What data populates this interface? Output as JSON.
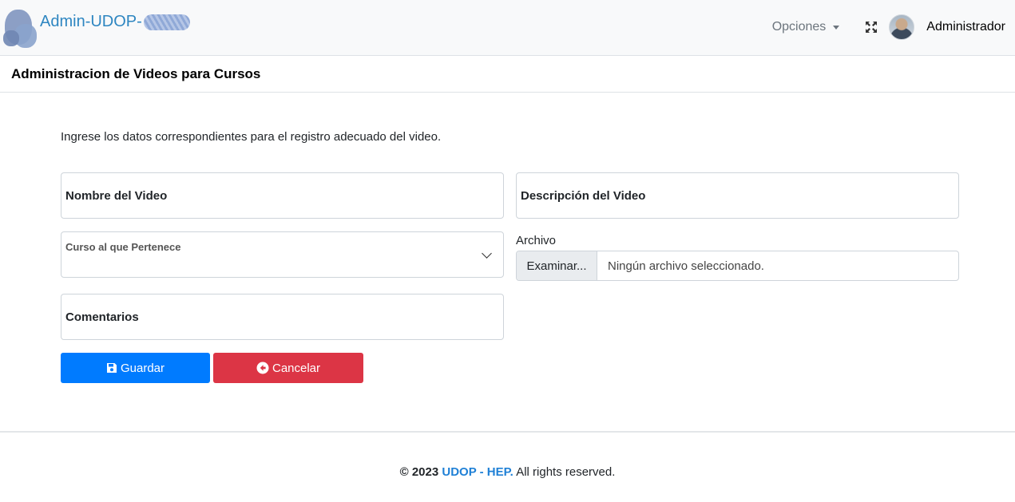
{
  "navbar": {
    "brand_text": "Admin-UDOP-",
    "options_label": "Opciones",
    "user_name": "Administrador",
    "icons": [
      "expand-icon",
      "avatar"
    ]
  },
  "page": {
    "title": "Administracion de Videos para Cursos",
    "intro": "Ingrese los datos correspondientes para el registro adecuado del video."
  },
  "form": {
    "nombre_label": "Nombre del Video",
    "descripcion_label": "Descripción del Video",
    "curso_label": "Curso al que Pertenece",
    "comentarios_label": "Comentarios",
    "archivo_label": "Archivo",
    "file_button": "Examinar...",
    "file_status": "Ningún archivo seleccionado.",
    "save_label": "Guardar",
    "cancel_label": "Cancelar"
  },
  "footer": {
    "copyright": "© 2023",
    "brand": "UDOP - HEP",
    "rights": "All rights reserved."
  },
  "colors": {
    "primary": "#007bff",
    "danger": "#dc3545",
    "brand": "#2e86c1",
    "navbar_bg": "#f8f9fa"
  }
}
